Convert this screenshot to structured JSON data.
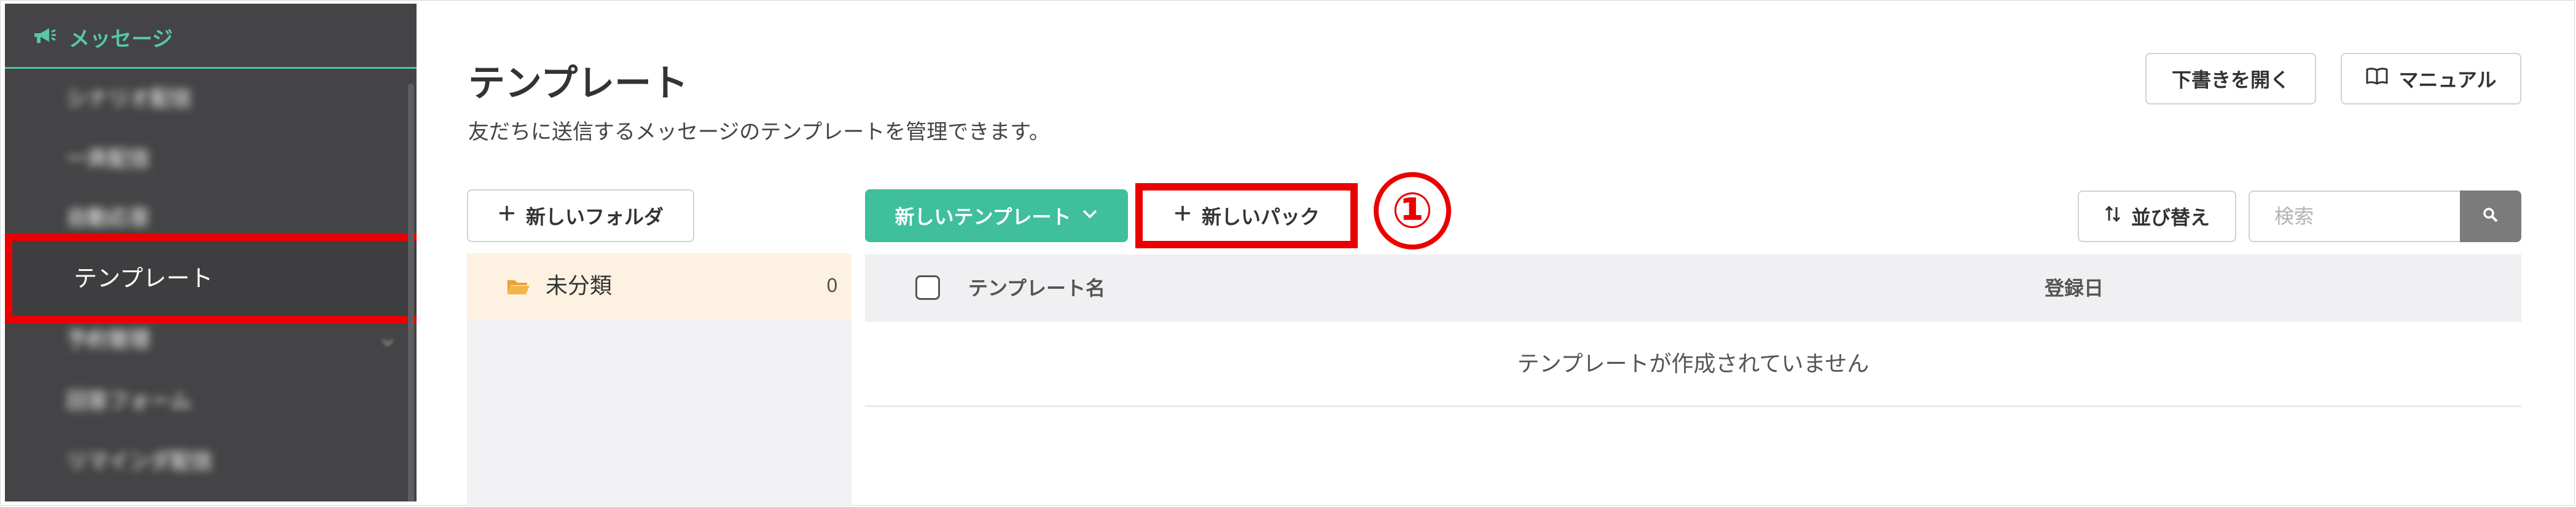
{
  "sidebar": {
    "section_label": "メッセージ",
    "items": [
      {
        "label": "シナリオ配信"
      },
      {
        "label": "一斉配信"
      },
      {
        "label": "自動応答"
      },
      {
        "label": "テンプレート"
      },
      {
        "label": "予約管理"
      },
      {
        "label": "回答フォーム"
      },
      {
        "label": "リマインダ配信"
      }
    ]
  },
  "header": {
    "title": "テンプレート",
    "description": "友だちに送信するメッセージのテンプレートを管理できます。",
    "open_draft_label": "下書きを開く",
    "manual_label": "マニュアル"
  },
  "toolbar": {
    "new_folder_label": "新しいフォルダ",
    "new_template_label": "新しいテンプレート",
    "new_pack_label": "新しいパック",
    "sort_label": "並び替え",
    "search_placeholder": "検索"
  },
  "annotation": {
    "step_marker": "①",
    "color": "#ea0000"
  },
  "folders": [
    {
      "name": "未分類",
      "count": "0"
    }
  ],
  "table": {
    "columns": [
      "テンプレート名",
      "登録日"
    ],
    "empty_message": "テンプレートが作成されていません"
  },
  "colors": {
    "accent": "#3fbf9c",
    "sidebar_bg": "#444446",
    "highlight": "#ea0000",
    "folder_selected_bg": "#fdf2e2"
  }
}
